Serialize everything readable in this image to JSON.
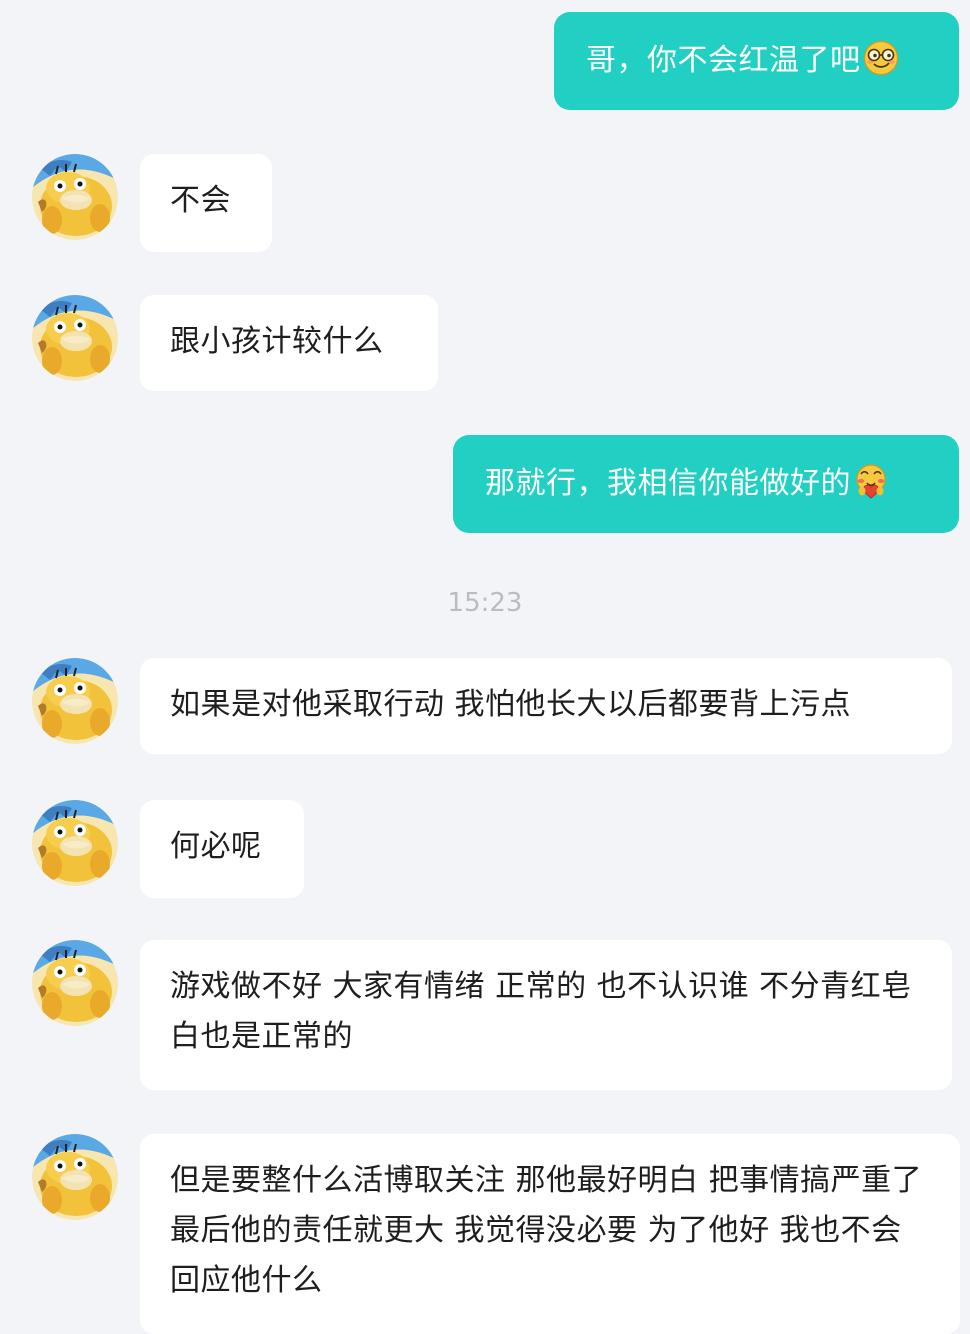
{
  "conversation": {
    "messages": [
      {
        "direction": "outgoing",
        "text": "哥，你不会红温了吧",
        "emoji": "smirk-glasses-emoji"
      },
      {
        "direction": "incoming",
        "text": "不会"
      },
      {
        "direction": "incoming",
        "text": "跟小孩计较什么"
      },
      {
        "direction": "outgoing",
        "text": "那就行，我相信你能做好的",
        "emoji": "blushing-heart-emoji"
      },
      {
        "direction": "incoming",
        "text": "如果是对他采取行动 我怕他长大以后都要背上污点"
      },
      {
        "direction": "incoming",
        "text": "何必呢"
      },
      {
        "direction": "incoming",
        "text": "游戏做不好 大家有情绪 正常的 也不认识谁 不分青红皂白也是正常的"
      },
      {
        "direction": "incoming",
        "text": "但是要整什么活博取关注 那他最好明白 把事情搞严重了 最后他的责任就更大 我觉得没必要 为了他好 我也不会回应他什么"
      }
    ],
    "timestamp": "15:23"
  },
  "colors": {
    "outgoing_bubble": "#21d0c3",
    "incoming_bubble": "#ffffff",
    "background": "#f3f4f8",
    "timestamp_text": "#b9bcc3"
  },
  "icons": {
    "avatar": "psyduck-avatar-icon"
  }
}
